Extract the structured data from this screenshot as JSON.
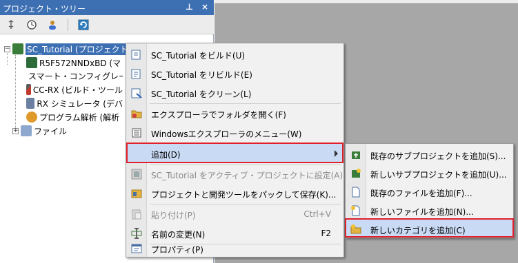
{
  "panel": {
    "title": "プロジェクト・ツリー",
    "pin_glyph": "⊥",
    "close_glyph": "×"
  },
  "tree": {
    "root": "SC_Tutorial (プロジェクト)",
    "items": [
      "R5F572NNDxBD (マ",
      "スマート・コンフィグレー",
      "CC-RX (ビルド・ツール",
      "RX シミュレータ (デバ",
      "プログラム解析 (解析",
      "ファイル"
    ]
  },
  "context_menu": {
    "items": [
      {
        "label": "SC_Tutorial をビルド(U)",
        "icon": "build-icon"
      },
      {
        "label": "SC_Tutorial をリビルド(E)",
        "icon": "rebuild-icon"
      },
      {
        "label": "SC_Tutorial をクリーン(L)",
        "icon": "clean-icon"
      },
      {
        "label": "エクスプローラでフォルダを開く(F)",
        "icon": "folder-open-icon"
      },
      {
        "label": "Windowsエクスプローラのメニュー(W)",
        "icon": "explorer-menu-icon"
      },
      {
        "label": "追加(D)",
        "icon": ""
      },
      {
        "label": "SC_Tutorial をアクティブ・プロジェクトに設定(A)",
        "icon": "active-project-icon"
      },
      {
        "label": "プロジェクトと開発ツールをパックして保存(K)...",
        "icon": "pack-save-icon"
      },
      {
        "label": "貼り付け(P)",
        "shortcut": "Ctrl+V",
        "icon": "paste-icon"
      },
      {
        "label": "名前の変更(N)",
        "shortcut": "F2",
        "icon": "rename-icon"
      },
      {
        "label": "プロパティ(P)",
        "icon": "properties-icon"
      }
    ]
  },
  "submenu": {
    "items": [
      {
        "label": "既存のサブプロジェクトを追加(S)...",
        "icon": "add-existing-subproject-icon"
      },
      {
        "label": "新しいサブプロジェクトを追加(U)...",
        "icon": "add-new-subproject-icon"
      },
      {
        "label": "既存のファイルを追加(F)...",
        "icon": "add-existing-file-icon"
      },
      {
        "label": "新しいファイルを追加(N)...",
        "icon": "add-new-file-icon"
      },
      {
        "label": "新しいカテゴリを追加(C)",
        "icon": "add-category-icon"
      }
    ]
  },
  "colors": {
    "title_bar": "#3d6fb3",
    "highlight": "#c9daf5",
    "callout_red": "#e0202b"
  }
}
